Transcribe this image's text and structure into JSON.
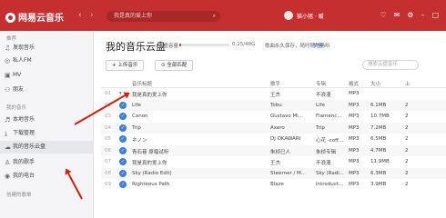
{
  "app": {
    "logo": "网易云音乐"
  },
  "topbar": {
    "search_text": "我是真的爱上你",
    "user_name": "猫小猪 · 暖",
    "nav_prev": "‹",
    "nav_next": "›"
  },
  "sidebar": {
    "section_recommend": "推荐",
    "section_my_music": "我的音乐",
    "section_playlists": "创建的歌单",
    "items": [
      {
        "label": "发现音乐",
        "icon": "music-note-icon"
      },
      {
        "label": "私人FM",
        "icon": "radio-icon"
      },
      {
        "label": "MV",
        "icon": "video-icon"
      },
      {
        "label": "朋友",
        "icon": "friends-icon"
      },
      {
        "label": "本地音乐",
        "icon": "local-music-icon"
      },
      {
        "label": "下载管理",
        "icon": "download-icon"
      },
      {
        "label": "我的音乐云盘",
        "icon": "cloud-icon"
      },
      {
        "label": "我的歌手",
        "icon": "singer-icon"
      },
      {
        "label": "我的电台",
        "icon": "station-icon"
      }
    ]
  },
  "main": {
    "title": "我的音乐云盘",
    "capacity_label": "云盘容量",
    "capacity_text": "0.15/40G",
    "capacity_fraction": 0.004,
    "ad_text": "歌曲永久保存，随时随地畅听",
    "ad_link": "扩容",
    "upload_button": "上传音乐",
    "match_all_button": "全部匹配",
    "filter_placeholder": "搜索云盘音乐"
  },
  "table": {
    "headers": [
      "音乐标题",
      "歌手",
      "专辑",
      "格式",
      "大小",
      "上"
    ],
    "rows": [
      {
        "idx": "01",
        "title": "我是真的爱上你",
        "artist": "王杰",
        "album": "不浪漫",
        "format": "MP3",
        "size": "",
        "date": ""
      },
      {
        "idx": "02",
        "title": "Life",
        "artist": "Tobu",
        "album": "Life",
        "format": "MP3",
        "size": "6.1MB",
        "date": "2"
      },
      {
        "idx": "03",
        "title": "Canon",
        "artist": "Gustavo Mi...",
        "album": "Flamenc...",
        "format": "MP3",
        "size": "10.7MB",
        "date": "2"
      },
      {
        "idx": "04",
        "title": "Trip",
        "artist": "Axero",
        "album": "Trip",
        "format": "MP3",
        "size": "7.2MB",
        "date": "2"
      },
      {
        "idx": "05",
        "title": "ネノン",
        "artist": "DJ OKAWARI",
        "album": "心花 -coff...",
        "format": "MP3",
        "size": "6.5MB",
        "date": "2"
      },
      {
        "idx": "06",
        "title": "青石巷 原唱试听",
        "artist": "朱桢已人",
        "album": "朱桢专辑",
        "format": "MP3",
        "size": "4.7MB",
        "date": "2"
      },
      {
        "idx": "07",
        "title": "我是真的爱上你",
        "artist": "王杰",
        "album": "不浪漫",
        "format": "MP3",
        "size": "11.9MB",
        "date": "2"
      },
      {
        "idx": "08",
        "title": "Sky (Radio Edit)",
        "artist": "Steerner / M...",
        "album": "Sky (Radi...",
        "format": "MP3",
        "size": "6.3MB",
        "date": "2"
      },
      {
        "idx": "09",
        "title": "Righteous Path",
        "artist": "Blaze",
        "album": "Introduct...",
        "format": "MP3",
        "size": "3.9MB",
        "date": "2"
      }
    ]
  },
  "colors": {
    "accent": "#c62f2f",
    "annotation": "#d81e06",
    "check": "#3b7de0"
  }
}
